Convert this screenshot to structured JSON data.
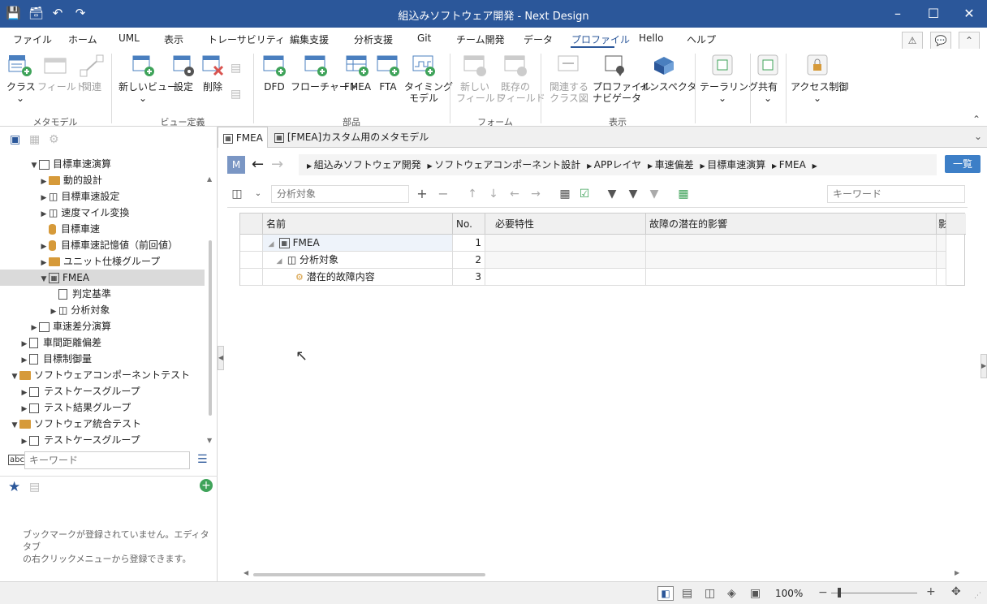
{
  "window": {
    "title": "組込みソフトウェア開発 - Next Design"
  },
  "menu": {
    "items": [
      "ファイル",
      "ホーム",
      "UML",
      "表示",
      "トレーサビリティ",
      "編集支援",
      "分析支援",
      "Git",
      "チーム開発",
      "データ",
      "プロファイル",
      "Hello",
      "ヘルプ"
    ],
    "active_index": 10
  },
  "ribbon": {
    "groups": [
      "メタモデル",
      "ビュー定義",
      "部品",
      "フォーム",
      "表示"
    ],
    "metamodel": {
      "class": "クラス",
      "field": "フィールド",
      "relation": "関連"
    },
    "viewdef": {
      "new_view": "新しいビュー",
      "settings": "設定",
      "delete": "削除"
    },
    "parts": {
      "dfd": "DFD",
      "flowchart": "フローチャート",
      "fmea": "FMEA",
      "fta": "FTA",
      "timing_1": "タイミング",
      "timing_2": "モデル"
    },
    "form": {
      "new_field_1": "新しい",
      "new_field_2": "フィールド",
      "existing_field_1": "既存の",
      "existing_field_2": "フィールド"
    },
    "display": {
      "rel_class_1": "関連する",
      "rel_class_2": "クラス図",
      "profile_nav_1": "プロファイル",
      "profile_nav_2": "ナビゲータ",
      "inspector": "インスペクタ"
    },
    "tailoring": "テーラリング",
    "share": "共有",
    "access": "アクセス制御"
  },
  "tree": [
    {
      "label": "目標車速演算",
      "indent": 2,
      "icon": "box",
      "arrow": "expanded"
    },
    {
      "label": "動的設計",
      "indent": 3,
      "icon": "folder",
      "arrow": "collapsed"
    },
    {
      "label": "目標車速設定",
      "indent": 3,
      "icon": "cube",
      "arrow": "collapsed"
    },
    {
      "label": "速度マイル変換",
      "indent": 3,
      "icon": "cube",
      "arrow": "collapsed"
    },
    {
      "label": "目標車速",
      "indent": 3,
      "icon": "cylinder",
      "arrow": "none"
    },
    {
      "label": "目標車速記憶値（前回値）",
      "indent": 3,
      "icon": "cylinder",
      "arrow": "collapsed"
    },
    {
      "label": "ユニット仕様グループ",
      "indent": 3,
      "icon": "folder",
      "arrow": "collapsed"
    },
    {
      "label": "FMEA",
      "indent": 3,
      "icon": "fmea",
      "arrow": "expanded",
      "selected": true
    },
    {
      "label": "判定基準",
      "indent": 4,
      "icon": "doc",
      "arrow": "none"
    },
    {
      "label": "分析対象",
      "indent": 4,
      "icon": "cube",
      "arrow": "collapsed"
    },
    {
      "label": "車速差分演算",
      "indent": 2,
      "icon": "box",
      "arrow": "collapsed"
    },
    {
      "label": "車間距離偏差",
      "indent": 1,
      "icon": "comp",
      "arrow": "collapsed"
    },
    {
      "label": "目標制御量",
      "indent": 1,
      "icon": "comp",
      "arrow": "collapsed"
    },
    {
      "label": "ソフトウェアコンポーネントテスト",
      "indent": 0,
      "icon": "folder",
      "arrow": "expanded"
    },
    {
      "label": "テストケースグループ",
      "indent": 1,
      "icon": "group",
      "arrow": "collapsed"
    },
    {
      "label": "テスト結果グループ",
      "indent": 1,
      "icon": "group",
      "arrow": "collapsed"
    },
    {
      "label": "ソフトウェア統合テスト",
      "indent": 0,
      "icon": "folder",
      "arrow": "expanded"
    },
    {
      "label": "テストケースグループ",
      "indent": 1,
      "icon": "group",
      "arrow": "collapsed"
    }
  ],
  "left_search": {
    "placeholder": "キーワード"
  },
  "bookmark": {
    "message_1": "ブックマークが登録されていません。エディタタブ",
    "message_2": "の右クリックメニューから登録できます。"
  },
  "tabs": [
    {
      "label": "FMEA"
    },
    {
      "label": "[FMEA]カスタム用のメタモデル"
    }
  ],
  "breadcrumb": {
    "m_badge": "M",
    "items": [
      "組込みソフトウェア開発",
      "ソフトウェアコンポーネント設計",
      "APPレイヤ",
      "車速偏差",
      "目標車速演算",
      "FMEA"
    ],
    "list_button": "一覧"
  },
  "toolbar": {
    "target_placeholder": "分析対象",
    "keyword_placeholder": "キーワード"
  },
  "grid": {
    "headers": [
      "名前",
      "No.",
      "必要特性",
      "故障の潜在的影響",
      "影"
    ],
    "rows": [
      {
        "name": "FMEA",
        "no": "1"
      },
      {
        "name": "分析対象",
        "no": "2"
      },
      {
        "name": "潜在的故障内容",
        "no": "3"
      }
    ]
  },
  "status": {
    "zoom": "100%"
  }
}
